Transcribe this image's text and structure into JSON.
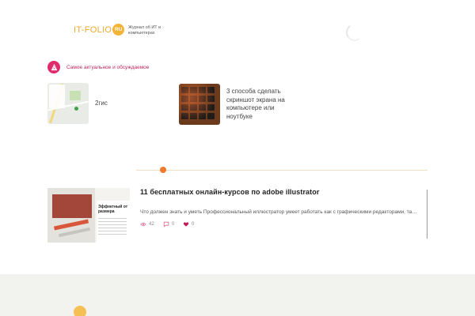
{
  "header": {
    "logo_text": "IT-FOLIO",
    "logo_badge": "RU",
    "tagline": "Журнал об ИТ и компьютерах"
  },
  "trending": {
    "heading": "Самое актуальное и обсуждаемое",
    "items": [
      {
        "title": "2гис"
      },
      {
        "title": "3 способа сделать скриншот экрана на компьютере или ноутбуке"
      }
    ]
  },
  "article": {
    "title": "11 бесплатных онлайн-курсов по adobe illustrator",
    "excerpt": "Что должен знать и уметь Профессиональный иллюстратор умеет работать как с графическими редакторами, так и с",
    "thumb_heading": "Эффектный от размера",
    "views": "42",
    "comments": "0",
    "likes": "0"
  },
  "colors": {
    "logo": "#f0a830",
    "accent_pink": "#e02a6a",
    "divider_dot": "#f07a2b",
    "footer_bg": "#f2f2ef"
  },
  "icons": {
    "trending": "flame-icon",
    "views": "eye-icon",
    "comments": "comment-icon",
    "likes": "heart-icon"
  }
}
